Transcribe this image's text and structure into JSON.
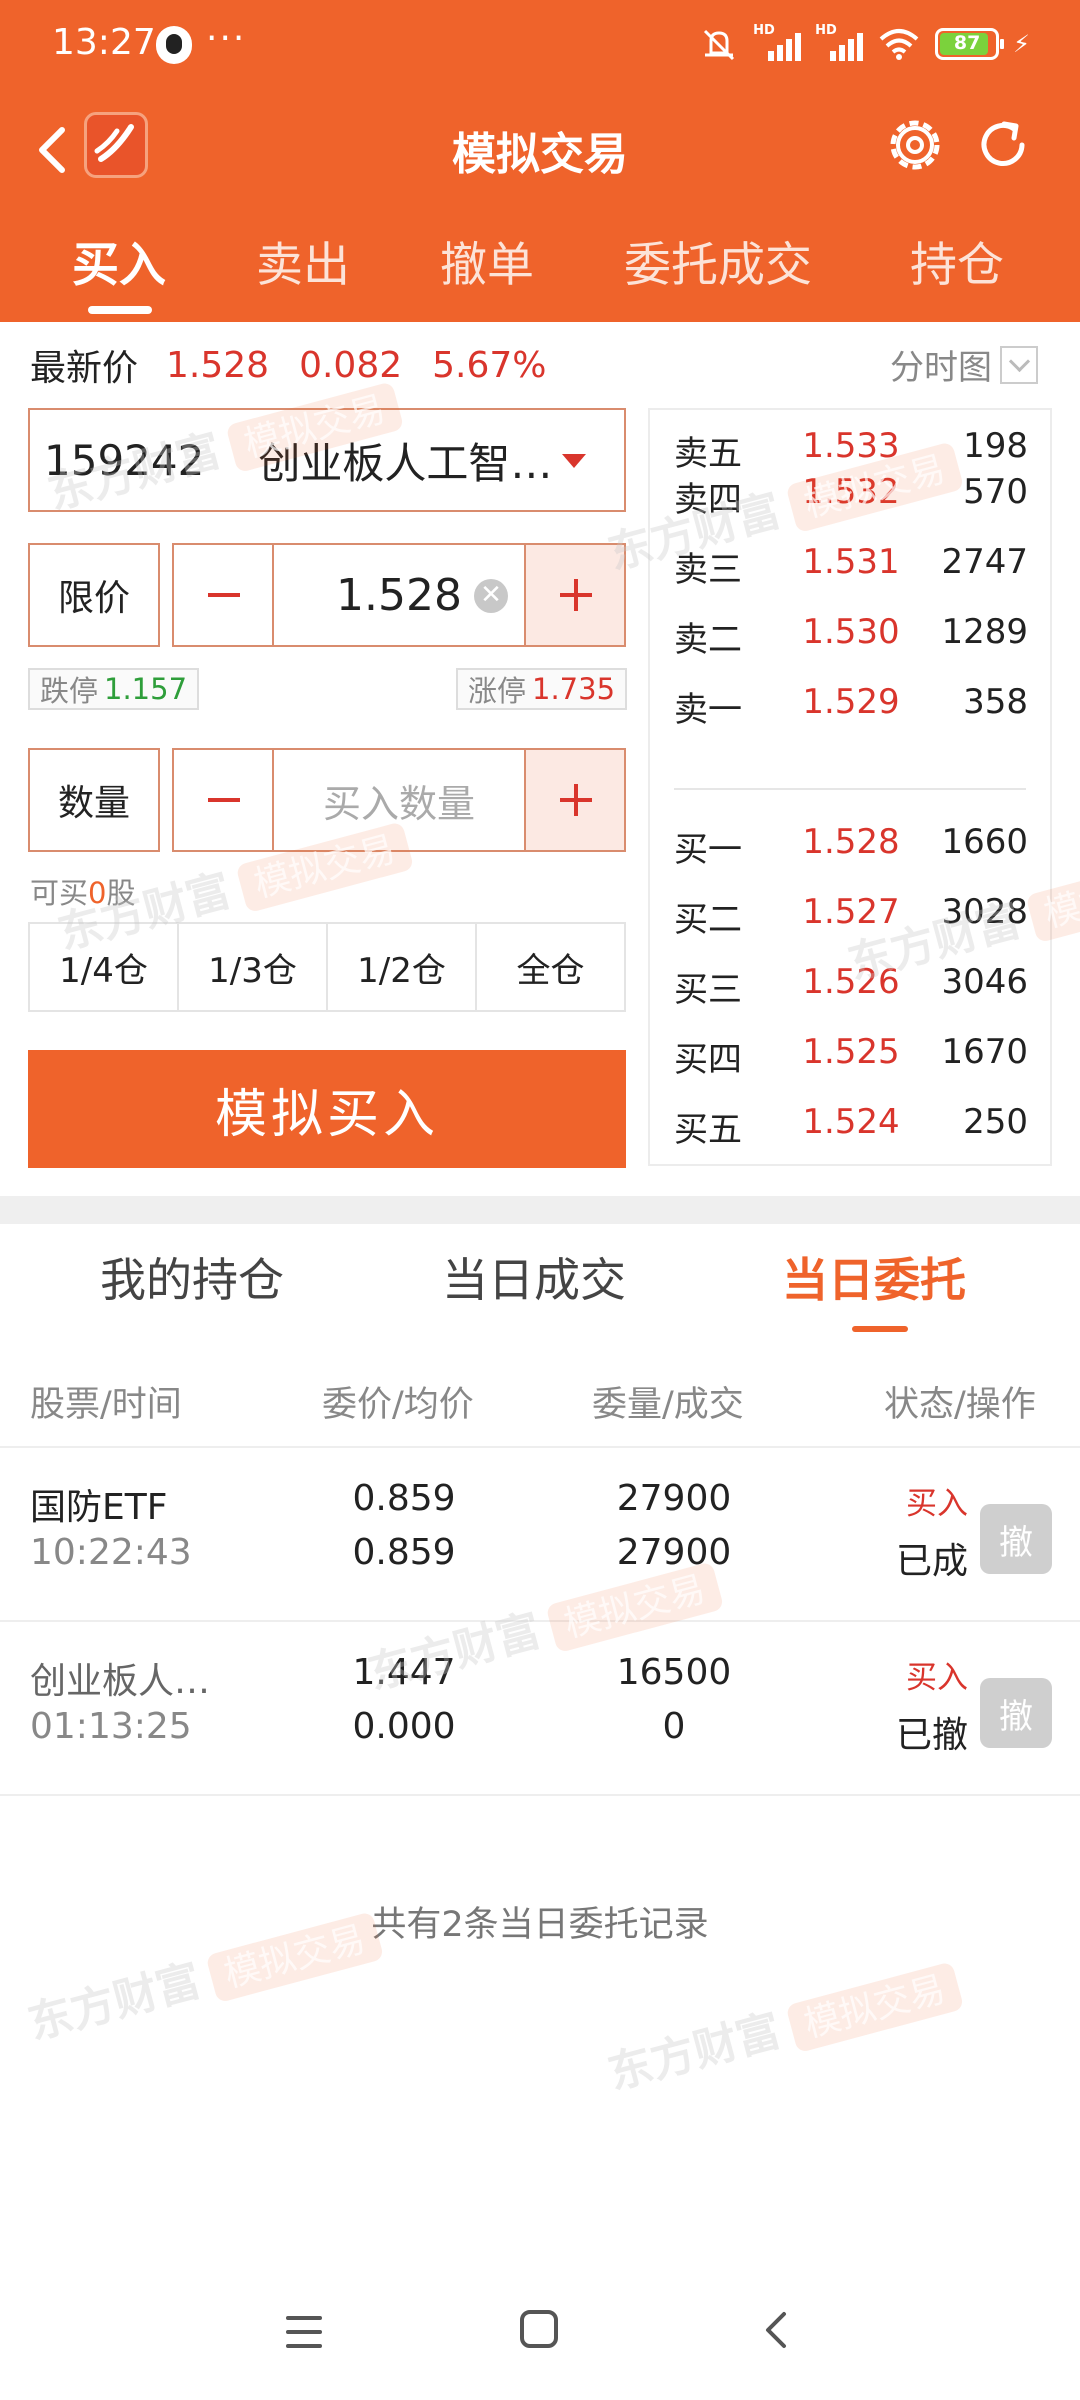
{
  "status_bar": {
    "time": "13:27",
    "dots": "···",
    "signal1_label": "HD",
    "signal2_label": "HD",
    "battery": "87",
    "icons": [
      "qq-icon",
      "mute-icon",
      "signal-icon",
      "wifi-icon",
      "battery-icon",
      "charging-icon"
    ]
  },
  "header": {
    "title": "模拟交易",
    "icons": [
      "back-icon",
      "app-logo-icon",
      "settings-gear-icon",
      "refresh-icon"
    ]
  },
  "tabs": [
    "买入",
    "卖出",
    "撤单",
    "委托成交",
    "持仓"
  ],
  "active_tab": "买入",
  "quote": {
    "label": "最新价",
    "price": "1.528",
    "change": "0.082",
    "change_pct": "5.67%",
    "chart_link": "分时图"
  },
  "stock": {
    "code": "159242",
    "name": "创业板人工智…"
  },
  "price_row": {
    "label": "限价",
    "value": "1.528"
  },
  "limits": {
    "down_label": "跌停",
    "down_value": "1.157",
    "up_label": "涨停",
    "up_value": "1.735"
  },
  "qty_row": {
    "label": "数量",
    "placeholder": "买入数量"
  },
  "available": {
    "prefix": "可买",
    "value": "0",
    "suffix": "股"
  },
  "position_buttons": [
    "1/4仓",
    "1/3仓",
    "1/2仓",
    "全仓"
  ],
  "buy_button": "模拟买入",
  "order_book": {
    "asks": [
      {
        "label": "卖五",
        "price": "1.533",
        "volume": "198"
      },
      {
        "label": "卖四",
        "price": "1.532",
        "volume": "570"
      },
      {
        "label": "卖三",
        "price": "1.531",
        "volume": "2747"
      },
      {
        "label": "卖二",
        "price": "1.530",
        "volume": "1289"
      },
      {
        "label": "卖一",
        "price": "1.529",
        "volume": "358"
      }
    ],
    "bids": [
      {
        "label": "买一",
        "price": "1.528",
        "volume": "1660"
      },
      {
        "label": "买二",
        "price": "1.527",
        "volume": "3028"
      },
      {
        "label": "买三",
        "price": "1.526",
        "volume": "3046"
      },
      {
        "label": "买四",
        "price": "1.525",
        "volume": "1670"
      },
      {
        "label": "买五",
        "price": "1.524",
        "volume": "250"
      }
    ]
  },
  "sub_tabs": [
    "我的持仓",
    "当日成交",
    "当日委托"
  ],
  "active_sub_tab": "当日委托",
  "table": {
    "headers": [
      "股票/时间",
      "委价/均价",
      "委量/成交",
      "状态/操作"
    ],
    "rows": [
      {
        "name": "国防ETF",
        "time": "10:22:43",
        "order_price": "0.859",
        "avg_price": "0.859",
        "order_qty": "27900",
        "filled_qty": "27900",
        "side": "买入",
        "status": "已成",
        "cancel": "撤"
      },
      {
        "name": "创业板人…",
        "time": "01:13:25",
        "order_price": "1.447",
        "avg_price": "0.000",
        "order_qty": "16500",
        "filled_qty": "0",
        "side": "买入",
        "status": "已撤",
        "cancel": "撤"
      }
    ]
  },
  "total_text": "共有2条当日委托记录",
  "watermark": {
    "brand": "东方财富",
    "tag": "模拟交易"
  },
  "colors": {
    "accent": "#EF632B",
    "up_red": "#D9352C",
    "down_green": "#2E9E3A"
  }
}
